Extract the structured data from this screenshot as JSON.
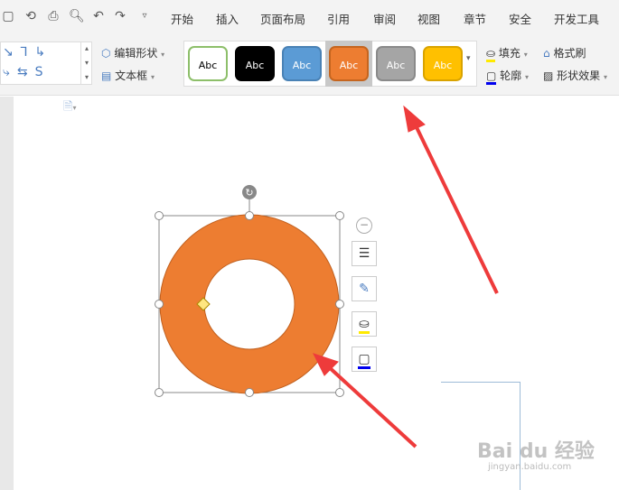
{
  "quick_access": [
    "save-icon",
    "format-painter-icon",
    "print-icon",
    "print-preview-icon",
    "undo-icon",
    "redo-icon",
    "customize-icon"
  ],
  "tabs": [
    "开始",
    "插入",
    "页面布局",
    "引用",
    "审阅",
    "视图",
    "章节",
    "安全",
    "开发工具"
  ],
  "ribbon": {
    "edit_shape": "编辑形状",
    "text_box": "文本框",
    "styles": [
      {
        "label": "Abc",
        "bg": "#ffffff",
        "fg": "#000000",
        "border": "#8dbf6a"
      },
      {
        "label": "Abc",
        "bg": "#000000",
        "fg": "#ffffff",
        "border": "#000000"
      },
      {
        "label": "Abc",
        "bg": "#5b9bd5",
        "fg": "#ffffff",
        "border": "#4a82b5"
      },
      {
        "label": "Abc",
        "bg": "#ed7d31",
        "fg": "#ffffff",
        "border": "#c5651f"
      },
      {
        "label": "Abc",
        "bg": "#a5a5a5",
        "fg": "#ffffff",
        "border": "#8a8a8a"
      },
      {
        "label": "Abc",
        "bg": "#ffc000",
        "fg": "#ffffff",
        "border": "#d9a300"
      }
    ],
    "fill": "填充",
    "format_painter": "格式刷",
    "outline": "轮廓",
    "shape_effects": "形状效果"
  },
  "shape": {
    "fill": "#ed7d31",
    "stroke": "#c0601f"
  },
  "watermark": {
    "brand": "Bai du 经验",
    "url": "jingyan.baidu.com"
  },
  "arrow_color": "#ee3b3b"
}
